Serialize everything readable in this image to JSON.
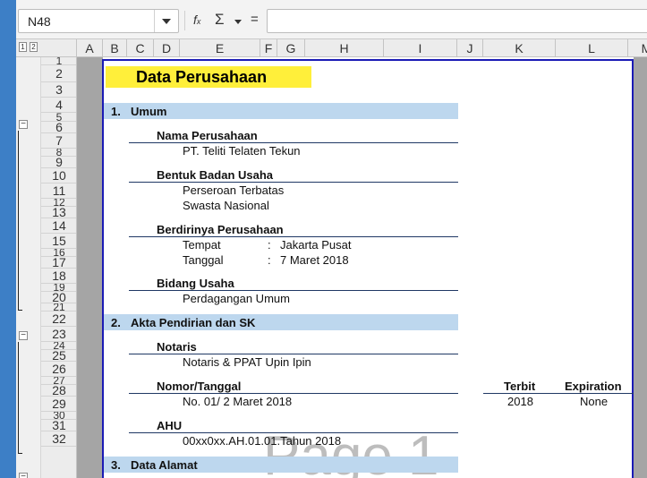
{
  "name_box": {
    "value": "N48"
  },
  "formula_bar": {
    "function_icon": "fx-icon",
    "sum_icon": "sigma-icon",
    "equals_label": "="
  },
  "outline_levels": [
    "1",
    "2"
  ],
  "columns": [
    "A",
    "B",
    "C",
    "D",
    "E",
    "F",
    "G",
    "H",
    "I",
    "J",
    "K",
    "L",
    "M"
  ],
  "rows": [
    "1",
    "2",
    "3",
    "4",
    "5",
    "6",
    "7",
    "8",
    "9",
    "10",
    "11",
    "12",
    "13",
    "14",
    "15",
    "16",
    "17",
    "18",
    "19",
    "20",
    "21",
    "22",
    "23",
    "24",
    "25",
    "26",
    "27",
    "28",
    "29",
    "30",
    "31",
    "32"
  ],
  "document": {
    "title": "Data Perusahaan",
    "sections": [
      {
        "number": "1.",
        "title": "Umum"
      },
      {
        "number": "2.",
        "title": "Akta Pendirian dan SK"
      },
      {
        "number": "3.",
        "title": "Data Alamat"
      }
    ],
    "nama_perusahaan": {
      "label": "Nama Perusahaan",
      "value": "PT. Teliti Telaten Tekun"
    },
    "bentuk_badan_usaha": {
      "label": "Bentuk Badan Usaha",
      "values": [
        "Perseroan Terbatas",
        "Swasta Nasional"
      ]
    },
    "berdirinya": {
      "label": "Berdirinya Perusahaan",
      "tempat_label": "Tempat",
      "tanggal_label": "Tanggal",
      "separator": ":",
      "tempat": "Jakarta Pusat",
      "tanggal": "7 Maret 2018"
    },
    "bidang_usaha": {
      "label": "Bidang Usaha",
      "value": "Perdagangan Umum"
    },
    "notaris": {
      "label": "Notaris",
      "value": "Notaris & PPAT Upin Ipin"
    },
    "nomor_tanggal": {
      "label": "Nomor/Tanggal",
      "value": "No. 01/ 2 Maret 2018",
      "terbit_label": "Terbit",
      "expiration_label": "Expiration",
      "terbit": "2018",
      "expiration": "None"
    },
    "ahu": {
      "label": "AHU",
      "value": "00xx0xx.AH.01.01.Tahun 2018"
    }
  },
  "watermark": "Page 1",
  "colors": {
    "page_border": "#1b1bb5",
    "section_band": "#bdd7ee",
    "title_fill": "#ffef3a",
    "gutter": "#a5a5a5"
  }
}
